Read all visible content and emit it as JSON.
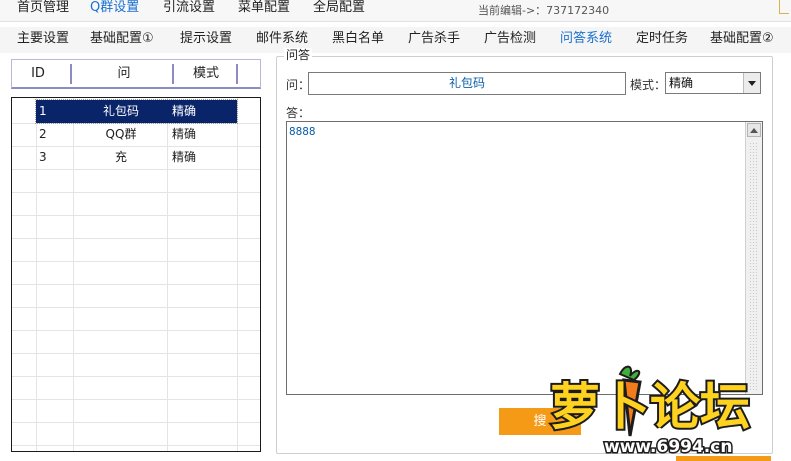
{
  "top_menu": {
    "items": [
      {
        "label": "首页管理",
        "active": false
      },
      {
        "label": "Q群设置",
        "active": true
      },
      {
        "label": "引流设置",
        "active": false
      },
      {
        "label": "菜单配置",
        "active": false
      },
      {
        "label": "全局配置",
        "active": false
      }
    ],
    "editing_label": "当前编辑->：737172340"
  },
  "sub_tabs": [
    {
      "label": "主要设置"
    },
    {
      "label": "基础配置①"
    },
    {
      "label": "提示设置"
    },
    {
      "label": "邮件系统"
    },
    {
      "label": "黑白名单"
    },
    {
      "label": "广告杀手"
    },
    {
      "label": "广告检测"
    },
    {
      "label": "问答系统",
      "active": true
    },
    {
      "label": "定时任务"
    },
    {
      "label": "基础配置②"
    }
  ],
  "list": {
    "columns": [
      "ID",
      "问",
      "模式"
    ],
    "rows": [
      {
        "id": "1",
        "question": "礼包码",
        "mode": "精确",
        "selected": true
      },
      {
        "id": "2",
        "question": "QQ群",
        "mode": "精确",
        "selected": false
      },
      {
        "id": "3",
        "question": "充",
        "mode": "精确",
        "selected": false
      }
    ]
  },
  "qa": {
    "group_title": "问答",
    "question_label": "问：",
    "question_value": "礼包码",
    "mode_label": "模式：",
    "mode_value": "精确",
    "answer_label": "答：",
    "answer_value": "8888",
    "action_button_label": "搜"
  },
  "watermark": {
    "text": "萝卜论坛",
    "url": "www.6994.cn"
  },
  "colors": {
    "accent_blue": "#1a6fd0",
    "selection_navy": "#0a246a",
    "orange": "#f59a16"
  }
}
